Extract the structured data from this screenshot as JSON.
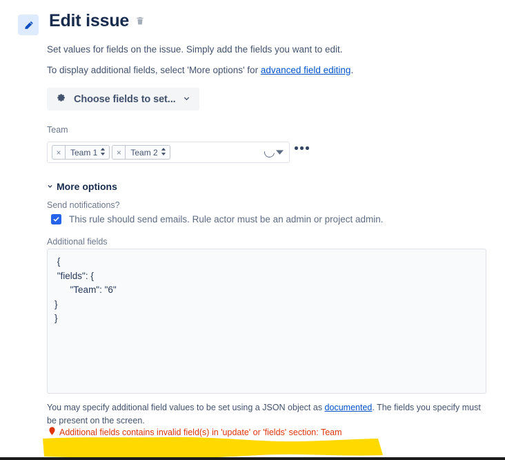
{
  "header": {
    "icon": "pencil-icon",
    "title": "Edit issue",
    "delete_icon": "trash-icon"
  },
  "description": {
    "line1": "Set values for fields on the issue. Simply add the fields you want to edit.",
    "line2_prefix": "To display additional fields, select 'More options' for ",
    "line2_link": "advanced field editing",
    "line2_suffix": "."
  },
  "choose_fields": {
    "icon": "gear-icon",
    "label": "Choose fields to set...",
    "chevron": "chevron-down-icon"
  },
  "team_field": {
    "label": "Team",
    "tags": [
      {
        "remove": "×",
        "label": "Team 1",
        "sort_icon": "sort-updown-icon"
      },
      {
        "remove": "×",
        "label": "Team 2",
        "sort_icon": "sort-updown-icon"
      }
    ],
    "spinner": "loading-spinner",
    "dropdown_icon": "dropdown-triangle-icon",
    "overflow_menu": "ellipsis-icon"
  },
  "more_options": {
    "chevron": "chevron-down-icon",
    "label": "More options"
  },
  "notifications": {
    "label": "Send notifications?",
    "checkbox_checked": true,
    "checkbox_label": "This rule should send emails. Rule actor must be an admin or project admin."
  },
  "additional_fields": {
    "label": "Additional fields",
    "value": " {\n \"fields\": {\n      \"Team\": \"6\"\n}\n}",
    "helper_prefix": "You may specify additional field values to be set using a JSON object as ",
    "helper_link": "documented",
    "helper_suffix": ". The fields you specify must be present on the screen."
  },
  "error": {
    "icon": "error-icon",
    "message": "Additional fields contains invalid field(s) in 'update' or 'fields' section: Team"
  },
  "annotation": {
    "highlight_color": "#FFD900"
  },
  "colors": {
    "accent": "#0052CC",
    "text": "#172B4D",
    "muted": "#6B778C",
    "error": "#DE350B",
    "checkbox": "#2563EB",
    "badge_bg": "#DEEBFF",
    "button_bg": "#F4F5F7",
    "field_border": "#DFE1E6",
    "textarea_bg": "#F9FAFC"
  }
}
